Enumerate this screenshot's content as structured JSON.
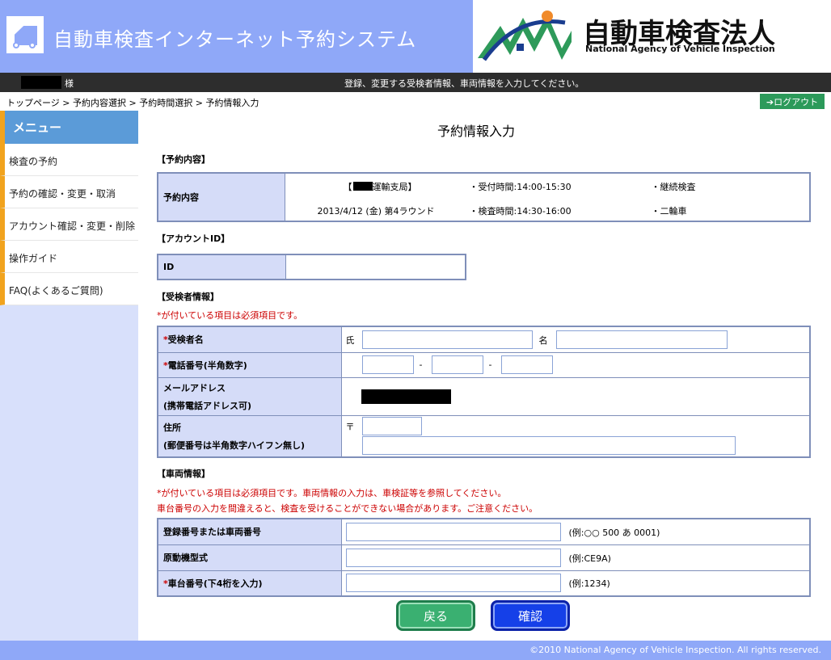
{
  "header": {
    "system_title": "自動車検査インターネット予約システム",
    "org_name": "自動車検査法人",
    "org_name_en": "National Agency of Vehicle Inspection"
  },
  "userbar": {
    "user_suffix": "様",
    "message": "登録、変更する受検者情報、車両情報を入力してください。"
  },
  "breadcrumb": "トップページ > 予約内容選択 > 予約時間選択 > 予約情報入力",
  "logout_label": "➔ログアウト",
  "sidebar": {
    "title": "メニュー",
    "items": [
      {
        "label": "検査の予約"
      },
      {
        "label": "予約の確認・変更・取消"
      },
      {
        "label": "アカウント確認・変更・削除"
      },
      {
        "label": "操作ガイド"
      },
      {
        "label": "FAQ(よくあるご質問)"
      }
    ]
  },
  "main": {
    "page_title": "予約情報入力",
    "reservation": {
      "section_title": "【予約内容】",
      "label": "予約内容",
      "office_prefix": "【",
      "office_suffix": "運輸支局】",
      "date_round": "2013/4/12 (金) 第4ラウンド",
      "reception_time": "・受付時間:14:00-15:30",
      "inspection_time": "・検査時間:14:30-16:00",
      "inspection_type": "・継続検査",
      "vehicle_type": "・二輪車"
    },
    "account": {
      "section_title": "【アカウントID】",
      "id_label": "ID",
      "id_value": ""
    },
    "examinee": {
      "section_title": "【受検者情報】",
      "required_note": "*が付いている項目は必須項目です。",
      "name_label": "受検者名",
      "surname_prefix": "氏",
      "given_prefix": "名",
      "phone_label": "電話番号(半角数字)",
      "phone_sep": "-",
      "email_label_1": "メールアドレス",
      "email_label_2": "(携帯電話アドレス可)",
      "address_label_1": "住所",
      "address_label_2": "(郵便番号は半角数字ハイフン無し)",
      "postal_mark": "〒",
      "required_mark": "*"
    },
    "vehicle": {
      "section_title": "【車両情報】",
      "note_1": "*が付いている項目は必須項目です。車両情報の入力は、車検証等を参照してください。",
      "note_2": "車台番号の入力を間違えると、検査を受けることができない場合があります。ご注意ください。",
      "reg_label": "登録番号または車両番号",
      "reg_example": "(例:○○ 500 あ 0001)",
      "motor_label": "原動機型式",
      "motor_example": "(例:CE9A)",
      "chassis_label": "車台番号(下4桁を入力)",
      "chassis_example": "(例:1234)"
    },
    "buttons": {
      "back": "戻る",
      "confirm": "確認"
    }
  },
  "footer": "©2010 National Agency of Vehicle Inspection. All rights reserved.",
  "colors": {
    "header_blue": "#8fa8f8",
    "menu_accent": "#f1a31e",
    "logout_green": "#2c9a5a",
    "required_red": "#cc0000",
    "confirm_blue": "#1540e8",
    "back_green": "#3ab071"
  }
}
